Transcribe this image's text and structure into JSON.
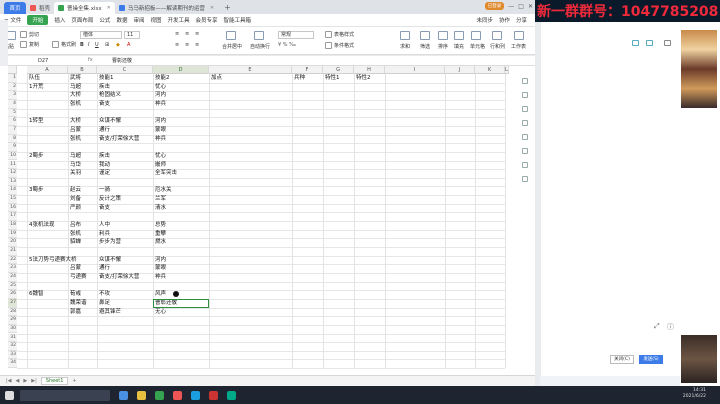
{
  "tabs": {
    "home": "首页",
    "tab1": "稻壳",
    "tab2": "曹操全集.xlsx",
    "tab3": "马马新招板——解读期刊的运营",
    "badge": "已登录"
  },
  "menu": {
    "file": "文件",
    "items": [
      "开始",
      "插入",
      "页面布局",
      "公式",
      "数据",
      "审阅",
      "视图",
      "开发工具",
      "会员专享",
      "智能工具箱"
    ],
    "right": [
      "未同步",
      "协作",
      "分享"
    ]
  },
  "ribbon": {
    "cut": "剪切",
    "copy": "复制",
    "paste": "粘贴",
    "format_painter": "格式刷",
    "font": "楷体",
    "font_size": "11",
    "merge": "合并居中",
    "wrap": "自动换行",
    "number_format": "常规",
    "cond_format": "条件格式",
    "table_style": "表格样式",
    "sum": "求和",
    "filter": "筛选",
    "sort": "排序",
    "fill": "填充",
    "cell": "单元格",
    "rowcol": "行和列",
    "sheet": "工作表"
  },
  "formula": {
    "name_box": "D27",
    "fx": "fx",
    "content": "曹彰还敬"
  },
  "columns": [
    "A",
    "B",
    "C",
    "D",
    "E",
    "F",
    "G",
    "H",
    "I",
    "J",
    "K",
    "L"
  ],
  "rows": [
    {
      "n": "1",
      "a": "队伍",
      "b": "武将",
      "c": "技能1",
      "d": "技能2",
      "e": "加点",
      "f": "兵种",
      "g": "特性1",
      "h": "特性2"
    },
    {
      "n": "2",
      "a": "1开荒",
      "b": "马超",
      "c": "疾击",
      "d": "忧心"
    },
    {
      "n": "3",
      "a": "",
      "b": "大桥",
      "c": "枪固结义",
      "d": "河内"
    },
    {
      "n": "4",
      "a": "",
      "b": "张机",
      "c": "奋支",
      "d": "衶兵"
    },
    {
      "n": "5"
    },
    {
      "n": "6",
      "a": "1转型",
      "b": "大桥",
      "c": "众谋不懈",
      "d": "河内"
    },
    {
      "n": "7",
      "a": "",
      "b": "吕蒙",
      "c": "通行",
      "d": "蒙眼"
    },
    {
      "n": "8",
      "a": "",
      "b": "张机",
      "c": "奋支/打荣徐大营",
      "d": "衶兵"
    },
    {
      "n": "9"
    },
    {
      "n": "10",
      "a": "2蜀步",
      "b": "马超",
      "c": "疾击",
      "d": "忧心"
    },
    {
      "n": "11",
      "a": "",
      "b": "马岱",
      "c": "我动",
      "d": "嵌师"
    },
    {
      "n": "12",
      "a": "",
      "b": "关羽",
      "c": "谨定",
      "d": "全军突击"
    },
    {
      "n": "13"
    },
    {
      "n": "14",
      "a": "3蜀步",
      "b": "赵云",
      "c": "一骑",
      "d": "厄水关"
    },
    {
      "n": "15",
      "a": "",
      "b": "刘备",
      "c": "反计之策",
      "d": "兰军"
    },
    {
      "n": "16",
      "a": "",
      "b": "严颜",
      "c": "奋支",
      "d": "清水"
    },
    {
      "n": "17"
    },
    {
      "n": "18",
      "a": "4张机法现",
      "b": "吕布",
      "c": "人中",
      "d": "总势"
    },
    {
      "n": "19",
      "a": "",
      "b": "张机",
      "c": "利兵",
      "d": "重攀"
    },
    {
      "n": "20",
      "a": "",
      "b": "貂蝉",
      "c": "步步为营",
      "d": "燃水"
    },
    {
      "n": "21"
    },
    {
      "n": "22",
      "a": "5法刀势弓递赛大桥",
      "b": "",
      "c": "众谋不懈",
      "d": "河内"
    },
    {
      "n": "23",
      "a": "",
      "b": "吕蒙",
      "c": "通行",
      "d": "蒙眼"
    },
    {
      "n": "24",
      "a": "",
      "b": "弓递赛",
      "c": "奋支/打荣徐大营",
      "d": "衶兵"
    },
    {
      "n": "25"
    },
    {
      "n": "26",
      "a": "6魏智",
      "b": "荀彧",
      "c": "不攻",
      "d": "风声"
    },
    {
      "n": "27",
      "a": "",
      "b": "魏荣谐",
      "c": "鼻足",
      "d": "曹彰还敬"
    },
    {
      "n": "28",
      "a": "",
      "b": "郭嘉",
      "c": "避其锋芒",
      "d": "无心"
    },
    {
      "n": "29"
    },
    {
      "n": "30"
    },
    {
      "n": "31"
    },
    {
      "n": "32"
    },
    {
      "n": "33"
    },
    {
      "n": "34"
    }
  ],
  "sheet_tabs": [
    "Sheet1"
  ],
  "chat": {
    "banner": "新一群群号：1047785208",
    "close_label": "关闭(C)",
    "send_label": "发送(S)"
  },
  "taskbar": {
    "time": "14:31",
    "date": "2021/6/22"
  },
  "colors": {
    "accent": "#36a351",
    "tab_active": "#3c7be8",
    "banner_text": "#f02a3a"
  }
}
